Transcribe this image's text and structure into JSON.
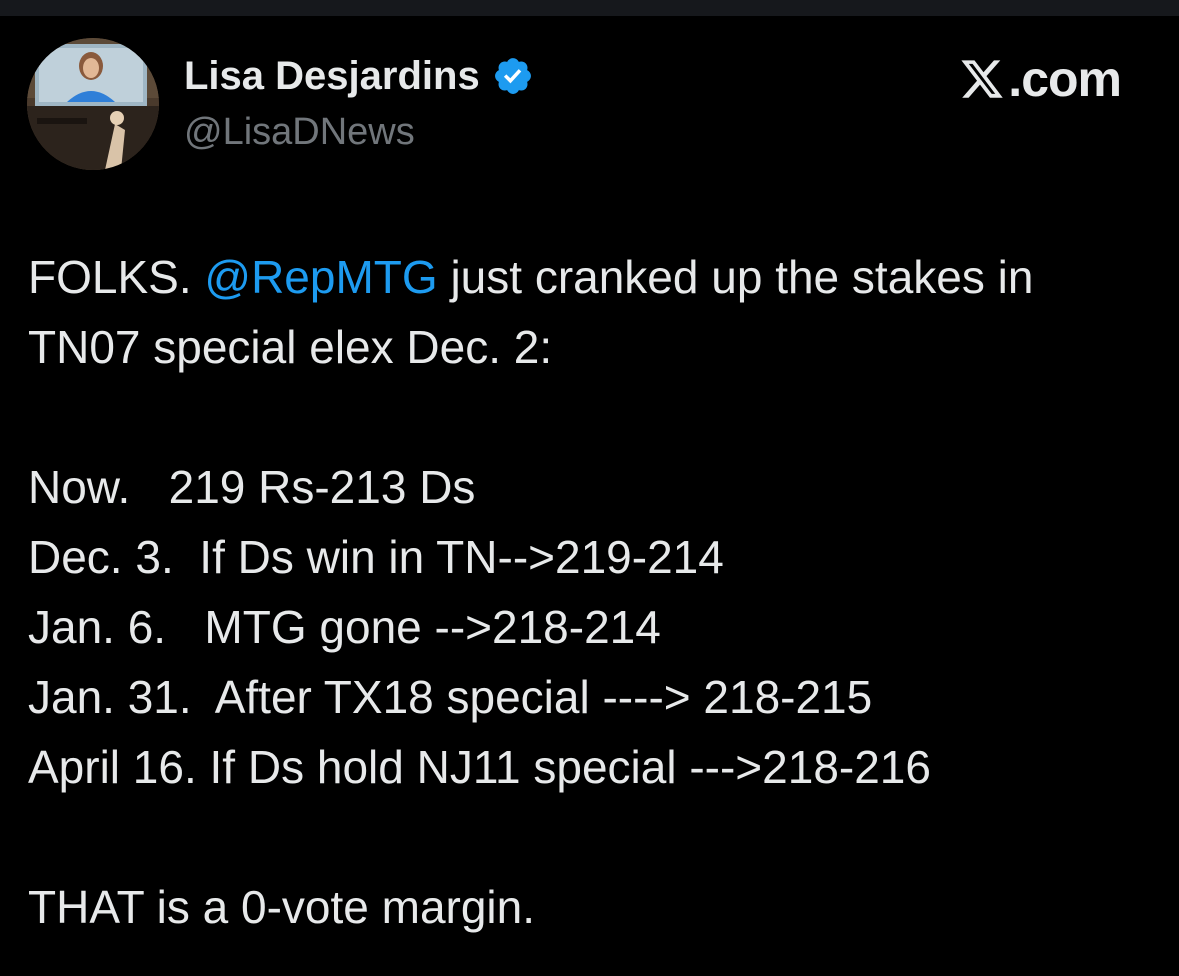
{
  "author": {
    "display_name": "Lisa Desjardins",
    "handle": "@LisaDNews",
    "verified": true
  },
  "brand": {
    "text": ".com",
    "icon": "x-logo-icon"
  },
  "tweet": {
    "line1_pre": "FOLKS. ",
    "mention": "@RepMTG",
    "line1_post": " just cranked up the stakes in",
    "line2": "TN07 special elex Dec. 2:",
    "timeline": [
      "Now.   219 Rs-213 Ds",
      "Dec. 3.  If Ds win in TN-->219-214",
      "Jan. 6.   MTG gone -->218-214",
      "Jan. 31.  After TX18 special ----> 218-215",
      "April 16. If Ds hold NJ11 special --->218-216"
    ],
    "conclusion": "THAT is a 0-vote margin."
  },
  "colors": {
    "background": "#000000",
    "text": "#e7e9ea",
    "secondary": "#71767b",
    "accent": "#1d9bf0"
  }
}
